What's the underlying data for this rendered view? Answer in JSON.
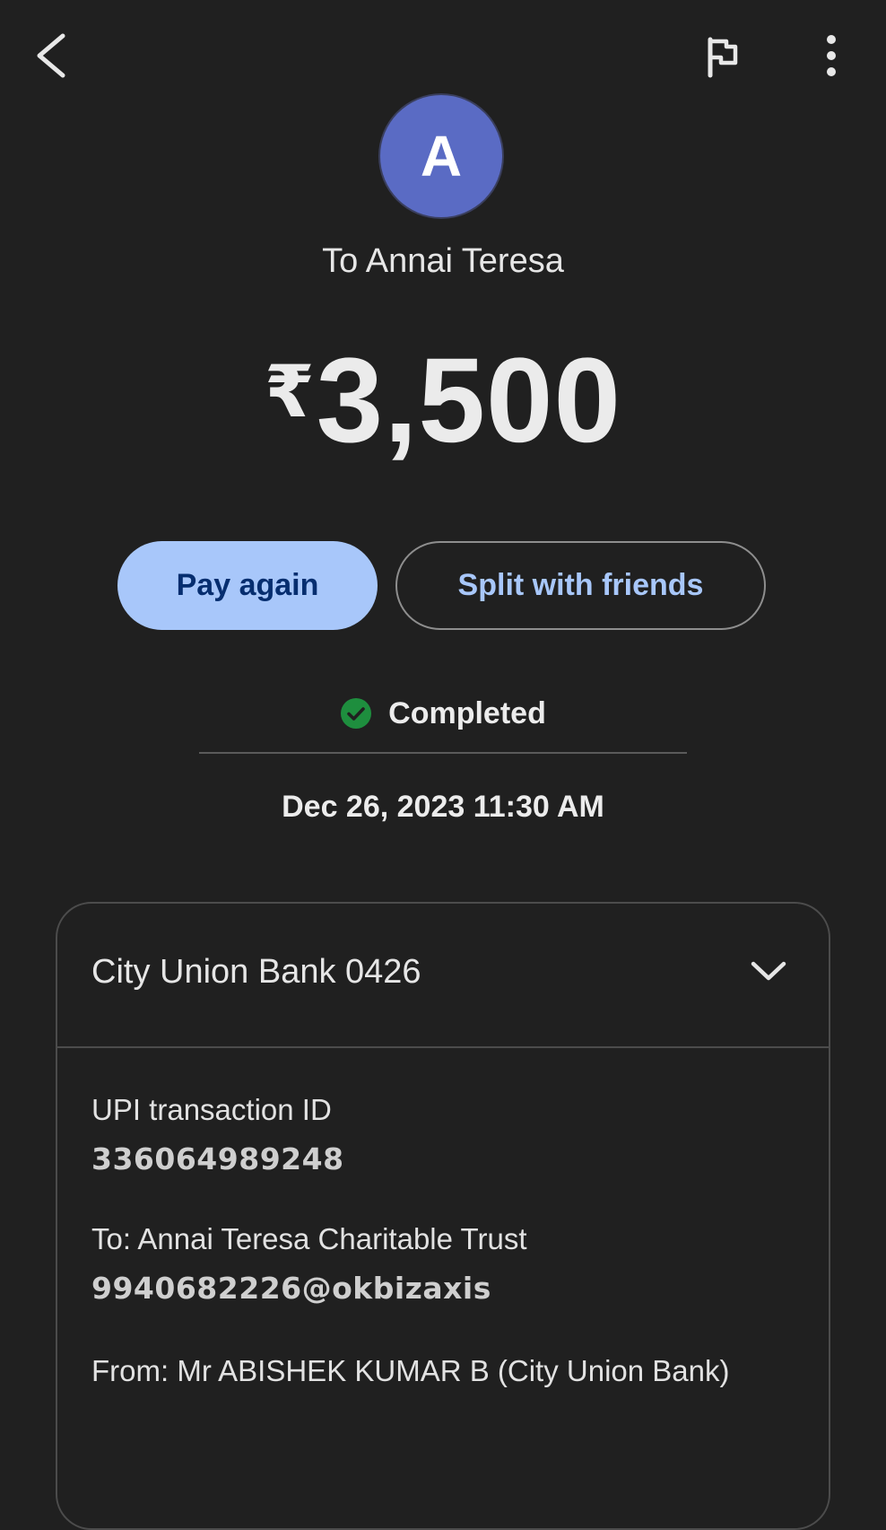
{
  "header": {
    "back_icon": "chevron-left-icon",
    "flag_icon": "flag-icon",
    "more_icon": "more-vert-icon"
  },
  "payee": {
    "avatar_letter": "A",
    "avatar_color": "#5a6bc4",
    "to_label": "To Annai Teresa"
  },
  "amount": {
    "currency_symbol": "₹",
    "value": "3,500"
  },
  "actions": {
    "pay_again_label": "Pay again",
    "split_label": "Split with friends"
  },
  "status": {
    "icon": "check-circle-icon",
    "color": "#1e8e3e",
    "text": "Completed",
    "datetime": "Dec 26, 2023 11:30 AM"
  },
  "details": {
    "bank_account": "City Union Bank 0426",
    "upi_id_label": "UPI transaction ID",
    "upi_id_value": "336064989248",
    "to_label": "To: Annai Teresa Charitable Trust",
    "to_value": "9940682226@okbizaxis",
    "from_label": "From: Mr ABISHEK KUMAR  B (City Union Bank)"
  }
}
